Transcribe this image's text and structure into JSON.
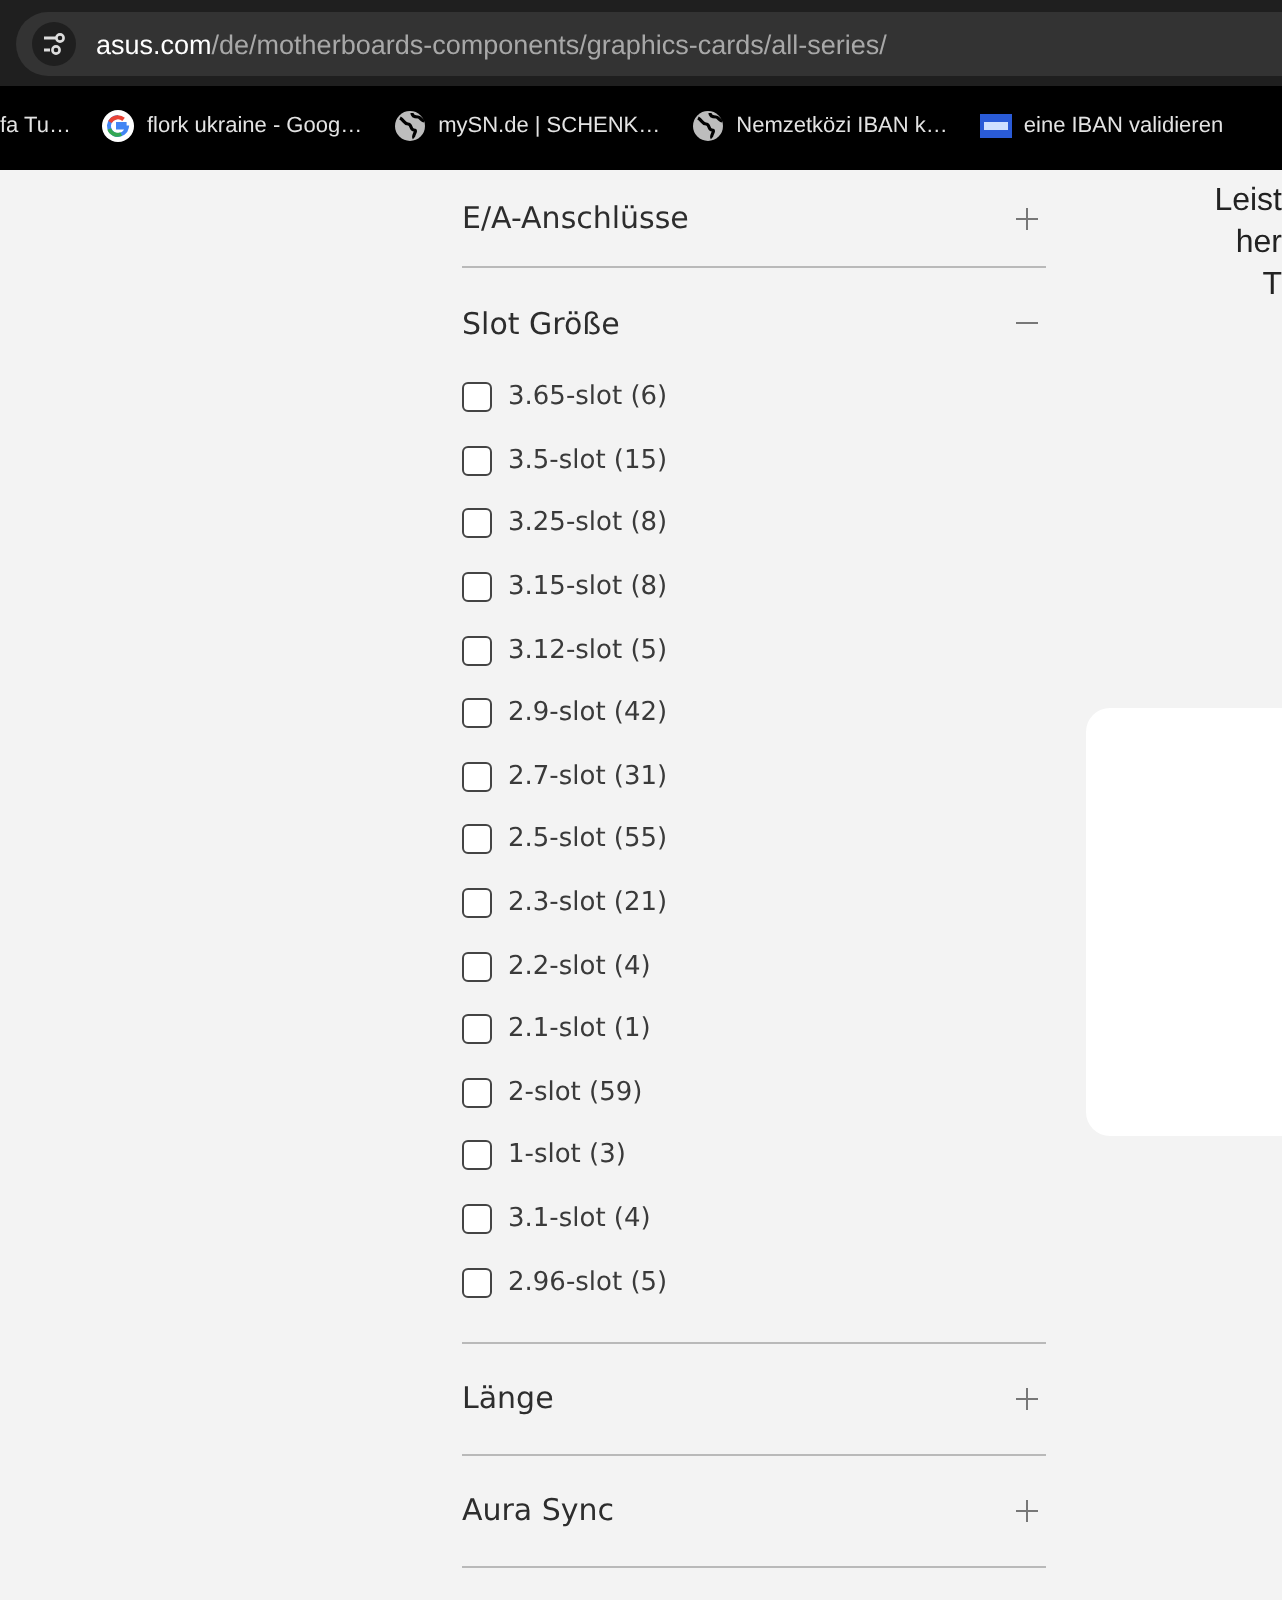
{
  "address_bar": {
    "domain": "asus.com",
    "path": "/de/motherboards-components/graphics-cards/all-series/"
  },
  "bookmarks": [
    {
      "kind": "none",
      "label": "fa Tu…"
    },
    {
      "kind": "google",
      "label": "flork ukraine - Goog…"
    },
    {
      "kind": "globe",
      "label": "mySN.de | SCHENK…"
    },
    {
      "kind": "globe",
      "label": "Nemzetközi IBAN k…"
    },
    {
      "kind": "iban",
      "label": "eine IBAN validieren"
    }
  ],
  "filters": [
    {
      "title": "E/A-Anschlüsse",
      "expanded": false
    },
    {
      "title": "Slot Größe",
      "expanded": true,
      "options": [
        {
          "label": "3.65-slot (6)",
          "checked": false
        },
        {
          "label": "3.5-slot (15)",
          "checked": false
        },
        {
          "label": "3.25-slot (8)",
          "checked": false
        },
        {
          "label": "3.15-slot (8)",
          "checked": false
        },
        {
          "label": "3.12-slot (5)",
          "checked": false
        },
        {
          "label": "2.9-slot (42)",
          "checked": false
        },
        {
          "label": "2.7-slot (31)",
          "checked": false
        },
        {
          "label": "2.5-slot (55)",
          "checked": false
        },
        {
          "label": "2.3-slot (21)",
          "checked": false
        },
        {
          "label": "2.2-slot (4)",
          "checked": false
        },
        {
          "label": "2.1-slot (1)",
          "checked": false
        },
        {
          "label": "2-slot (59)",
          "checked": false
        },
        {
          "label": "1-slot (3)",
          "checked": false
        },
        {
          "label": "3.1-slot (4)",
          "checked": false
        },
        {
          "label": "2.96-slot (5)",
          "checked": false
        }
      ]
    },
    {
      "title": "Länge",
      "expanded": false
    },
    {
      "title": "Aura Sync",
      "expanded": false
    }
  ],
  "side_text": [
    "Leist",
    "her",
    "T"
  ]
}
